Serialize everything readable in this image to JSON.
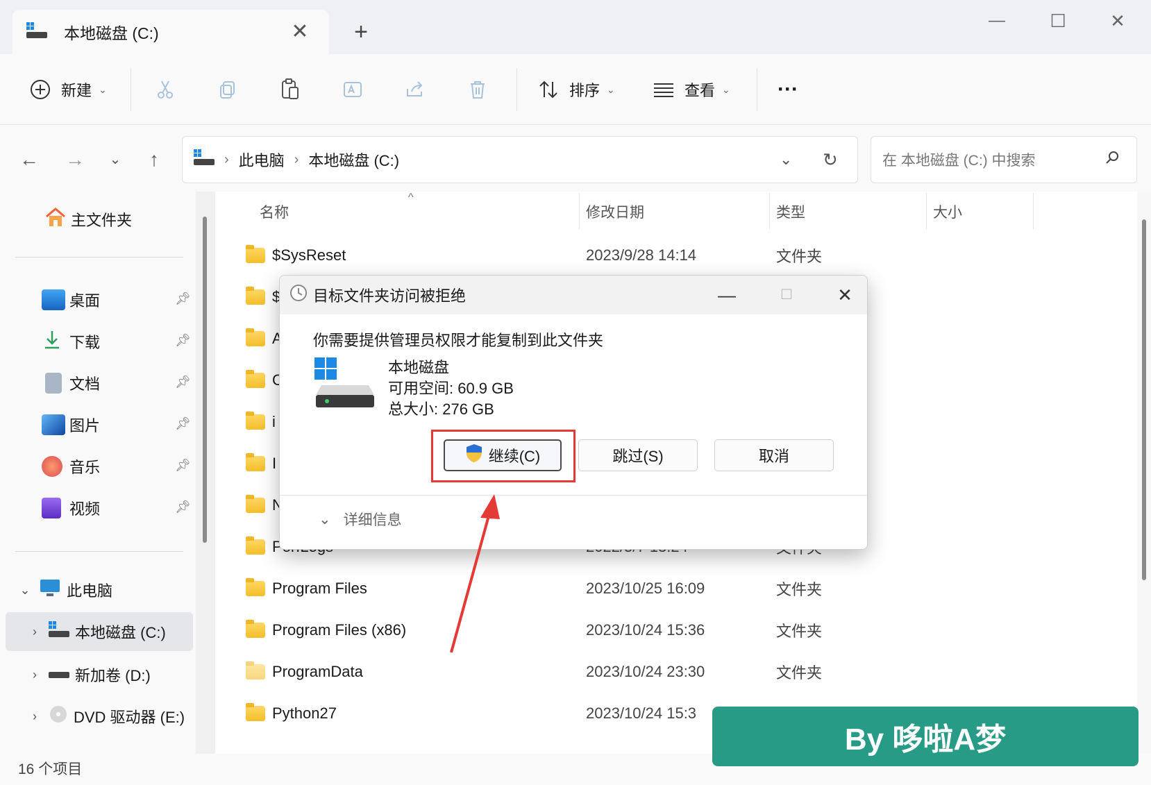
{
  "tab": {
    "title": "本地磁盘 (C:)",
    "close": "✕",
    "new_tab": "+"
  },
  "window_controls": {
    "minimize": "—",
    "maximize": "☐",
    "close": "✕"
  },
  "toolbar": {
    "new_label": "新建",
    "sort_label": "排序",
    "view_label": "查看",
    "more_label": "···"
  },
  "address": {
    "crumbs": [
      "此电脑",
      "本地磁盘 (C:)"
    ],
    "search_placeholder": "在 本地磁盘 (C:) 中搜索"
  },
  "sidebar": {
    "home": "主文件夹",
    "quick": [
      {
        "label": "桌面",
        "icon": "desktop-icon",
        "color": "#1e88e5"
      },
      {
        "label": "下载",
        "icon": "download-icon",
        "color": "#2e9e5b"
      },
      {
        "label": "文档",
        "icon": "document-icon",
        "color": "#7d8ea3"
      },
      {
        "label": "图片",
        "icon": "pictures-icon",
        "color": "#1976d2"
      },
      {
        "label": "音乐",
        "icon": "music-icon",
        "color": "#ef6c3e"
      },
      {
        "label": "视频",
        "icon": "video-icon",
        "color": "#7b4bd6"
      }
    ],
    "this_pc": "此电脑",
    "drives": [
      "本地磁盘 (C:)",
      "新加卷 (D:)",
      "DVD 驱动器 (E:)"
    ]
  },
  "columns": {
    "name": "名称",
    "modified": "修改日期",
    "type": "类型",
    "size": "大小"
  },
  "files": [
    {
      "name": "$SysReset",
      "date": "2023/9/28 14:14",
      "type": "文件夹"
    },
    {
      "name": "$",
      "date": "",
      "type": ""
    },
    {
      "name": "A",
      "date": "",
      "type": ""
    },
    {
      "name": "C",
      "date": "",
      "type": ""
    },
    {
      "name": "i",
      "date": "",
      "type": ""
    },
    {
      "name": "I",
      "date": "",
      "type": ""
    },
    {
      "name": "N",
      "date": "",
      "type": ""
    },
    {
      "name": "PerfLogs",
      "date": "2022/5/7 13:24",
      "type": "文件夹"
    },
    {
      "name": "Program Files",
      "date": "2023/10/25 16:09",
      "type": "文件夹"
    },
    {
      "name": "Program Files (x86)",
      "date": "2023/10/24 15:36",
      "type": "文件夹"
    },
    {
      "name": "ProgramData",
      "date": "2023/10/24 23:30",
      "type": "文件夹"
    },
    {
      "name": "Python27",
      "date": "2023/10/24 15:3",
      "type": ""
    }
  ],
  "status": {
    "count": "16 个项目"
  },
  "dialog": {
    "title": "目标文件夹访问被拒绝",
    "message": "你需要提供管理员权限才能复制到此文件夹",
    "drive_name": "本地磁盘",
    "free_space": "可用空间: 60.9 GB",
    "total_size": "总大小: 276 GB",
    "continue_label": "继续(C)",
    "skip_label": "跳过(S)",
    "cancel_label": "取消",
    "details_label": "详细信息"
  },
  "banner": {
    "text": "By 哆啦A梦"
  },
  "colors": {
    "highlight": "#e53935",
    "banner": "#279b86"
  }
}
